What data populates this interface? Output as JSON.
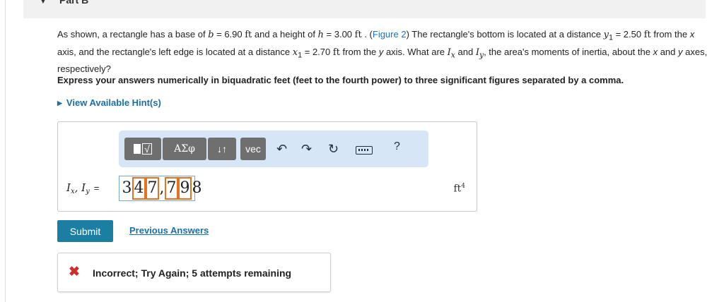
{
  "part": {
    "title": "Part B",
    "caret": "▼"
  },
  "question": {
    "t1": "As shown, a rectangle has a base of ",
    "b_sym": "b",
    "t2": " = 6.90 ",
    "unit_ft": "ft",
    "t3": " and a height of ",
    "h_sym": "h",
    "t4": " = 3.00 ",
    "t5": " . (",
    "figure_link": "Figure 2",
    "t6": ") The rectangle's bottom is located at a distance ",
    "y1_sym": "y",
    "sub1": "1",
    "t7": " = 2.50 ",
    "t8": " from the ",
    "x_word": "x",
    "t9": " axis, and the rectangle's left edge is located at a distance ",
    "x1_sym": "x",
    "t10": " = 2.70 ",
    "t11": " from the ",
    "y_word": "y",
    "t12": " axis. What are ",
    "I_sym": "I",
    "sub_x": "x",
    "t13": " and ",
    "sub_y": "y",
    "t14": ", the area's moments of inertia, about the ",
    "t15": " and ",
    "t16": " axes, respectively?"
  },
  "instruction": "Express your answers numerically in biquadratic feet (feet to the fourth power) to three significant figures separated by a comma.",
  "hints_link": "View Available Hint(s)",
  "toolbar": {
    "templates_label": "√",
    "greek_label": "ΑΣφ",
    "arrows_label": "↓↑",
    "vec_label": "vec",
    "undo_icon": "undo-icon",
    "redo_icon": "redo-icon",
    "reset_icon": "reset-icon",
    "keyboard_icon": "keyboard-icon",
    "help_label": "?"
  },
  "answer": {
    "label_I": "I",
    "label_sub_x": "x",
    "label_comma": ", ",
    "label_sub_y": "y",
    "label_eq": "=",
    "value": "347,798",
    "highlighted_chars": [
      1,
      2,
      4,
      5
    ],
    "unit": "ft",
    "unit_power": "4",
    "highlight_color": "#e8711f"
  },
  "submit_label": "Submit",
  "previous_answers_label": "Previous Answers",
  "feedback": {
    "icon": "close-icon",
    "icon_glyph": "✖",
    "message": "Incorrect; Try Again; 5 attempts remaining",
    "icon_color": "#d12b2b"
  }
}
